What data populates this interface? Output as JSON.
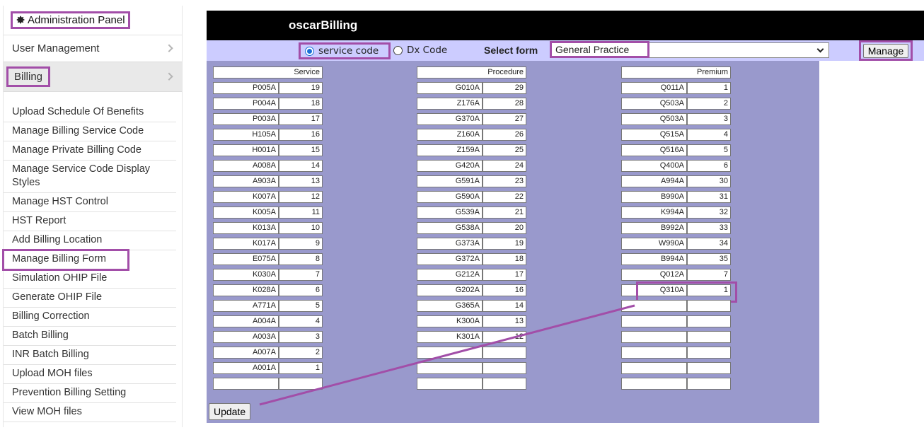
{
  "sidebar": {
    "admin_title": "Administration Panel",
    "user_management": "User Management",
    "billing": "Billing",
    "items": [
      "Upload Schedule Of Benefits",
      "Manage Billing Service Code",
      "Manage Private Billing Code",
      "Manage Service Code Display Styles",
      "Manage HST Control",
      "HST Report",
      "Add Billing Location",
      "Manage Billing Form",
      "Simulation OHIP File",
      "Generate OHIP File",
      "Billing Correction",
      "Batch Billing",
      "INR Batch Billing",
      "Upload MOH files",
      "Prevention Billing Setting",
      "View MOH files"
    ]
  },
  "header": {
    "title": "oscarBilling"
  },
  "controls": {
    "radio_service": "service code",
    "radio_dx": "Dx Code",
    "select_label": "Select form",
    "select_value": "General Practice",
    "manage_label": "Manage"
  },
  "columns": {
    "service": {
      "header": "Service",
      "rows": [
        {
          "code": "P005A",
          "num": "19"
        },
        {
          "code": "P004A",
          "num": "18"
        },
        {
          "code": "P003A",
          "num": "17"
        },
        {
          "code": "H105A",
          "num": "16"
        },
        {
          "code": "H001A",
          "num": "15"
        },
        {
          "code": "A008A",
          "num": "14"
        },
        {
          "code": "A903A",
          "num": "13"
        },
        {
          "code": "K007A",
          "num": "12"
        },
        {
          "code": "K005A",
          "num": "11"
        },
        {
          "code": "K013A",
          "num": "10"
        },
        {
          "code": "K017A",
          "num": "9"
        },
        {
          "code": "E075A",
          "num": "8"
        },
        {
          "code": "K030A",
          "num": "7"
        },
        {
          "code": "K028A",
          "num": "6"
        },
        {
          "code": "A771A",
          "num": "5"
        },
        {
          "code": "A004A",
          "num": "4"
        },
        {
          "code": "A003A",
          "num": "3"
        },
        {
          "code": "A007A",
          "num": "2"
        },
        {
          "code": "A001A",
          "num": "1"
        },
        {
          "code": "",
          "num": ""
        }
      ]
    },
    "procedure": {
      "header": "Procedure",
      "rows": [
        {
          "code": "G010A",
          "num": "29"
        },
        {
          "code": "Z176A",
          "num": "28"
        },
        {
          "code": "G370A",
          "num": "27"
        },
        {
          "code": "Z160A",
          "num": "26"
        },
        {
          "code": "Z159A",
          "num": "25"
        },
        {
          "code": "G420A",
          "num": "24"
        },
        {
          "code": "G591A",
          "num": "23"
        },
        {
          "code": "G590A",
          "num": "22"
        },
        {
          "code": "G539A",
          "num": "21"
        },
        {
          "code": "G538A",
          "num": "20"
        },
        {
          "code": "G373A",
          "num": "19"
        },
        {
          "code": "G372A",
          "num": "18"
        },
        {
          "code": "G212A",
          "num": "17"
        },
        {
          "code": "G202A",
          "num": "16"
        },
        {
          "code": "G365A",
          "num": "14"
        },
        {
          "code": "K300A",
          "num": "13"
        },
        {
          "code": "K301A",
          "num": "12"
        },
        {
          "code": "",
          "num": ""
        },
        {
          "code": "",
          "num": ""
        },
        {
          "code": "",
          "num": ""
        }
      ]
    },
    "premium": {
      "header": "Premium",
      "rows": [
        {
          "code": "Q011A",
          "num": "1"
        },
        {
          "code": "Q503A",
          "num": "2"
        },
        {
          "code": "Q503A",
          "num": "3"
        },
        {
          "code": "Q515A",
          "num": "4"
        },
        {
          "code": "Q516A",
          "num": "5"
        },
        {
          "code": "Q400A",
          "num": "6"
        },
        {
          "code": "A994A",
          "num": "30"
        },
        {
          "code": "B990A",
          "num": "31"
        },
        {
          "code": "K994A",
          "num": "32"
        },
        {
          "code": "B992A",
          "num": "33"
        },
        {
          "code": "W990A",
          "num": "34"
        },
        {
          "code": "B994A",
          "num": "35"
        },
        {
          "code": "Q012A",
          "num": "7"
        },
        {
          "code": "Q310A",
          "num": "1"
        },
        {
          "code": "",
          "num": ""
        },
        {
          "code": "",
          "num": ""
        },
        {
          "code": "",
          "num": ""
        },
        {
          "code": "",
          "num": ""
        },
        {
          "code": "",
          "num": ""
        },
        {
          "code": "",
          "num": ""
        }
      ]
    }
  },
  "update_label": "Update",
  "annotation_color": "#a24ea8"
}
